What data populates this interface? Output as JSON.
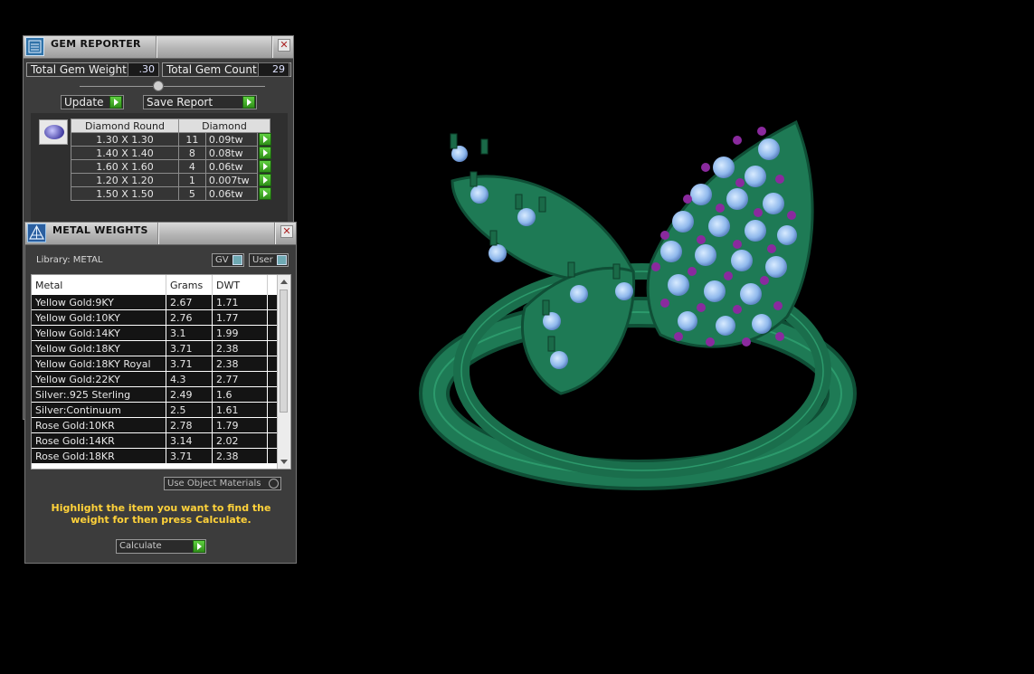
{
  "gem_reporter": {
    "title": "GEM REPORTER",
    "close_glyph": "✕",
    "total_weight_label": "Total Gem Weight",
    "total_weight_value": ".30",
    "total_count_label": "Total Gem Count",
    "total_count_value": "29",
    "update_label": "Update",
    "save_report_label": "Save Report",
    "gem_headers": [
      "Diamond Round",
      "Diamond"
    ],
    "gems": [
      {
        "size": "1.30 X 1.30",
        "count": "11",
        "weight": "0.09tw"
      },
      {
        "size": "1.40 X 1.40",
        "count": "8",
        "weight": "0.08tw"
      },
      {
        "size": "1.60 X 1.60",
        "count": "4",
        "weight": "0.06tw"
      },
      {
        "size": "1.20 X 1.20",
        "count": "1",
        "weight": "0.007tw"
      },
      {
        "size": "1.50 X 1.50",
        "count": "5",
        "weight": "0.06tw"
      }
    ]
  },
  "metal_weights": {
    "title": "METAL WEIGHTS",
    "close_glyph": "✕",
    "library_label": "Library: METAL",
    "gv_label": "GV",
    "user_label": "User",
    "columns": [
      "Metal",
      "Grams",
      "DWT"
    ],
    "rows": [
      {
        "metal": "Yellow Gold:9KY",
        "grams": "2.67",
        "dwt": "1.71"
      },
      {
        "metal": "Yellow Gold:10KY",
        "grams": "2.76",
        "dwt": "1.77"
      },
      {
        "metal": "Yellow Gold:14KY",
        "grams": "3.1",
        "dwt": "1.99"
      },
      {
        "metal": "Yellow Gold:18KY",
        "grams": "3.71",
        "dwt": "2.38"
      },
      {
        "metal": "Yellow Gold:18KY Royal",
        "grams": "3.71",
        "dwt": "2.38"
      },
      {
        "metal": "Yellow Gold:22KY",
        "grams": "4.3",
        "dwt": "2.77"
      },
      {
        "metal": "Silver:.925 Sterling",
        "grams": "2.49",
        "dwt": "1.6"
      },
      {
        "metal": "Silver:Continuum",
        "grams": "2.5",
        "dwt": "1.61"
      },
      {
        "metal": "Rose Gold:10KR",
        "grams": "2.78",
        "dwt": "1.79"
      },
      {
        "metal": "Rose Gold:14KR",
        "grams": "3.14",
        "dwt": "2.02"
      },
      {
        "metal": "Rose Gold:18KR",
        "grams": "3.71",
        "dwt": "2.38"
      }
    ],
    "use_object_materials_label": "Use Object Materials",
    "hint_text": "Highlight the item you want to find the weight for then press Calculate.",
    "calculate_label": "Calculate"
  },
  "viewport": {
    "metal_color": "#1e7a55",
    "metal_dark": "#0f4f36",
    "stone_color": "#9ec6f4",
    "prong_color": "#8a2a9e"
  }
}
